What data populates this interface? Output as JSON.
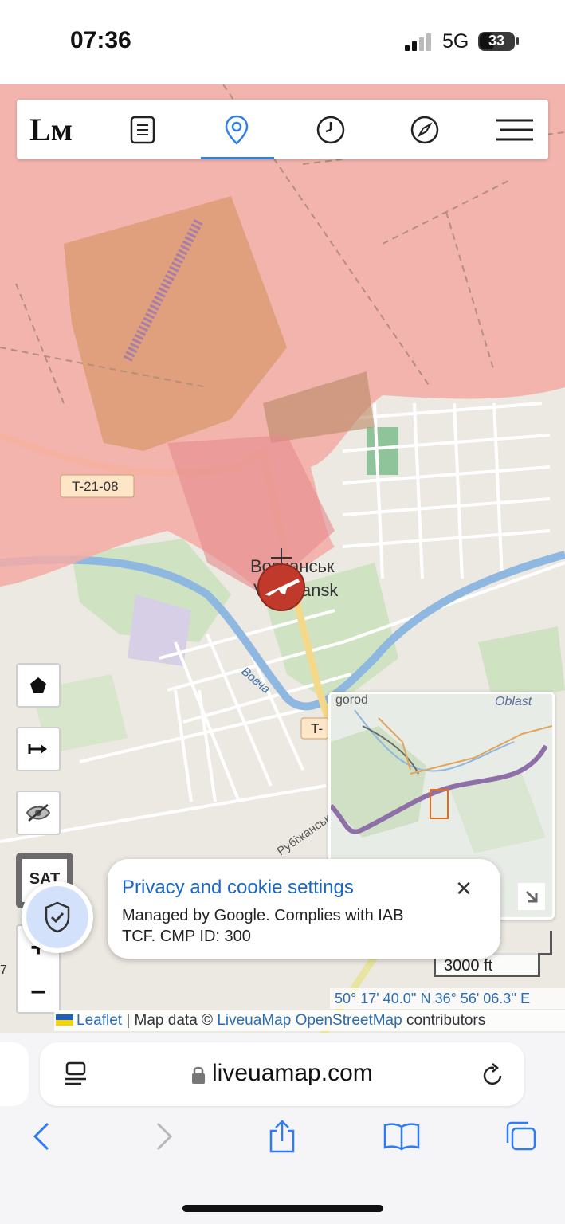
{
  "status_bar": {
    "time": "07:36",
    "network": "5G",
    "battery": "33"
  },
  "map": {
    "labels": {
      "vovchansk_en_top": "Vovchans'k",
      "road_t2108": "T-21-08",
      "road_t_short": "T-",
      "city_uk": "Вовчанськ",
      "city_en": "Vovchansk",
      "river": "Вовча",
      "street": "Рубіжанськ",
      "left_edge": "7"
    },
    "colors": {
      "occupied": "#f4b3ad",
      "contested": "#e89c7a",
      "water": "#a9c7e6",
      "green": "#c8dfb8"
    },
    "sat_label": "SAT",
    "zoom_in": "+",
    "zoom_out": "−",
    "minimap": {
      "top_left_text": "gorod",
      "top_right_text": "Oblast"
    },
    "scale_label": "3000 ft",
    "coordinates": "50° 17' 40.0'' N 36° 56' 06.3'' E",
    "attribution": {
      "leaflet": "Leaflet",
      "sep": " | Map data © ",
      "liveuamap": "LiveuaMap",
      "osm": "OpenStreetMap",
      "contributors": " contributors"
    }
  },
  "top_nav": {
    "logo": "Lм",
    "items": [
      "list-icon",
      "pin-icon",
      "clock-icon",
      "compass-icon",
      "menu-icon"
    ],
    "active": "pin-icon"
  },
  "privacy": {
    "title": "Privacy and cookie settings",
    "body": "Managed by Google. Complies with IAB TCF. CMP ID: 300",
    "close": "✕"
  },
  "browser": {
    "url": "liveuamap.com"
  }
}
